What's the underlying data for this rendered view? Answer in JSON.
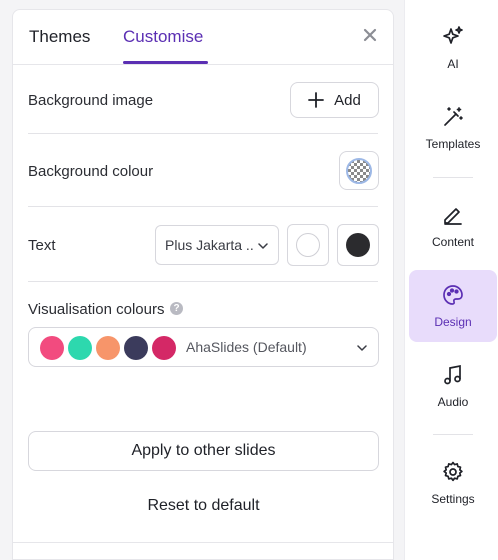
{
  "tabs": {
    "themes": "Themes",
    "customise": "Customise",
    "active": "customise"
  },
  "rows": {
    "background_image": {
      "label": "Background image",
      "add_label": "Add"
    },
    "background_colour": {
      "label": "Background colour"
    },
    "text": {
      "label": "Text",
      "font": "Plus Jakarta ...",
      "light_color": "#ffffff",
      "dark_color": "#2b2b2e"
    },
    "visualisation": {
      "label": "Visualisation colours",
      "help": "?",
      "palette_name": "AhaSlides (Default)",
      "colors": [
        "#f24b7f",
        "#2dd8ae",
        "#f7956a",
        "#3b3b5c",
        "#d42866"
      ]
    }
  },
  "actions": {
    "apply": "Apply to other slides",
    "reset": "Reset to default"
  },
  "sidebar": {
    "items": [
      {
        "label": "AI",
        "icon": "sparkles-icon"
      },
      {
        "label": "Templates",
        "icon": "magic-wand-icon"
      },
      {
        "label": "Content",
        "icon": "pencil-icon"
      },
      {
        "label": "Design",
        "icon": "palette-icon",
        "active": true
      },
      {
        "label": "Audio",
        "icon": "music-note-icon"
      },
      {
        "label": "Settings",
        "icon": "gear-icon"
      }
    ]
  },
  "colors": {
    "accent": "#5b2fb3",
    "accent_bg": "#e8dcfb"
  }
}
